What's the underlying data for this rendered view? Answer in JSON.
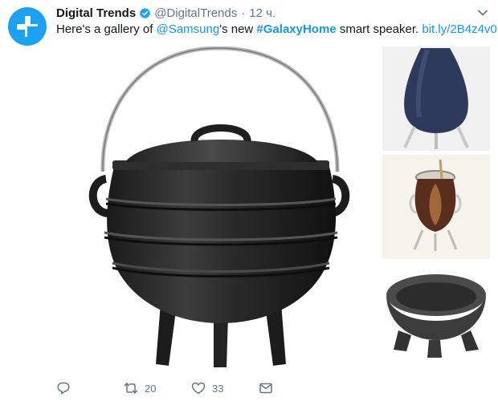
{
  "tweet": {
    "author_name": "Digital Trends",
    "handle": "@DigitalTrends",
    "separator": "·",
    "time": "12 ч.",
    "text": {
      "part1": "Here's a gallery of ",
      "mention": "@Samsung",
      "part2": "'s new ",
      "hashtag": "#GalaxyHome",
      "part3": " smart speaker. ",
      "link": "bit.ly/2B4z4v0"
    }
  },
  "actions": {
    "retweet_count": "20",
    "like_count": "33"
  },
  "colors": {
    "accent": "#1da1f2",
    "link": "#1b95e0",
    "muted": "#657786"
  },
  "icons": [
    "plus-logo-icon",
    "verified-badge-icon",
    "chevron-down-icon",
    "reply-icon",
    "retweet-icon",
    "like-heart-icon",
    "direct-message-icon"
  ]
}
